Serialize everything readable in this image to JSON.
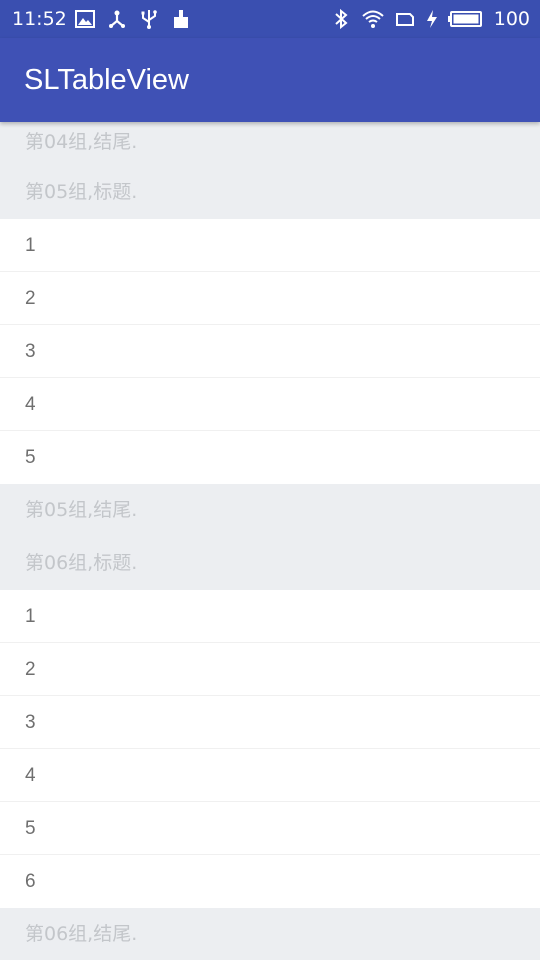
{
  "status_bar": {
    "time": "11:52",
    "battery_level": "100",
    "left_icons": [
      "image-icon",
      "usb-branch-icon",
      "usb-icon",
      "cleaner-icon"
    ],
    "right_icons": [
      "bluetooth-icon",
      "wifi-icon",
      "sim-icon",
      "charging-icon",
      "battery-icon"
    ],
    "background": "#3a4fb0"
  },
  "app_bar": {
    "title": "SLTableView",
    "background": "#3f51b5"
  },
  "list": {
    "rows": [
      {
        "kind": "section",
        "text": "第04组,结尾."
      },
      {
        "kind": "section",
        "text": "第05组,标题."
      },
      {
        "kind": "item",
        "text": "1"
      },
      {
        "kind": "item",
        "text": "2"
      },
      {
        "kind": "item",
        "text": "3"
      },
      {
        "kind": "item",
        "text": "4"
      },
      {
        "kind": "item",
        "text": "5"
      },
      {
        "kind": "section",
        "text": "第05组,结尾."
      },
      {
        "kind": "section",
        "text": "第06组,标题."
      },
      {
        "kind": "item",
        "text": "1"
      },
      {
        "kind": "item",
        "text": "2"
      },
      {
        "kind": "item",
        "text": "3"
      },
      {
        "kind": "item",
        "text": "4"
      },
      {
        "kind": "item",
        "text": "5"
      },
      {
        "kind": "item",
        "text": "6"
      },
      {
        "kind": "section",
        "text": "第06组,结尾."
      }
    ],
    "section_background": "#eceef1",
    "section_text_color": "#c3c6ca",
    "item_text_color": "#6f6f6f"
  }
}
